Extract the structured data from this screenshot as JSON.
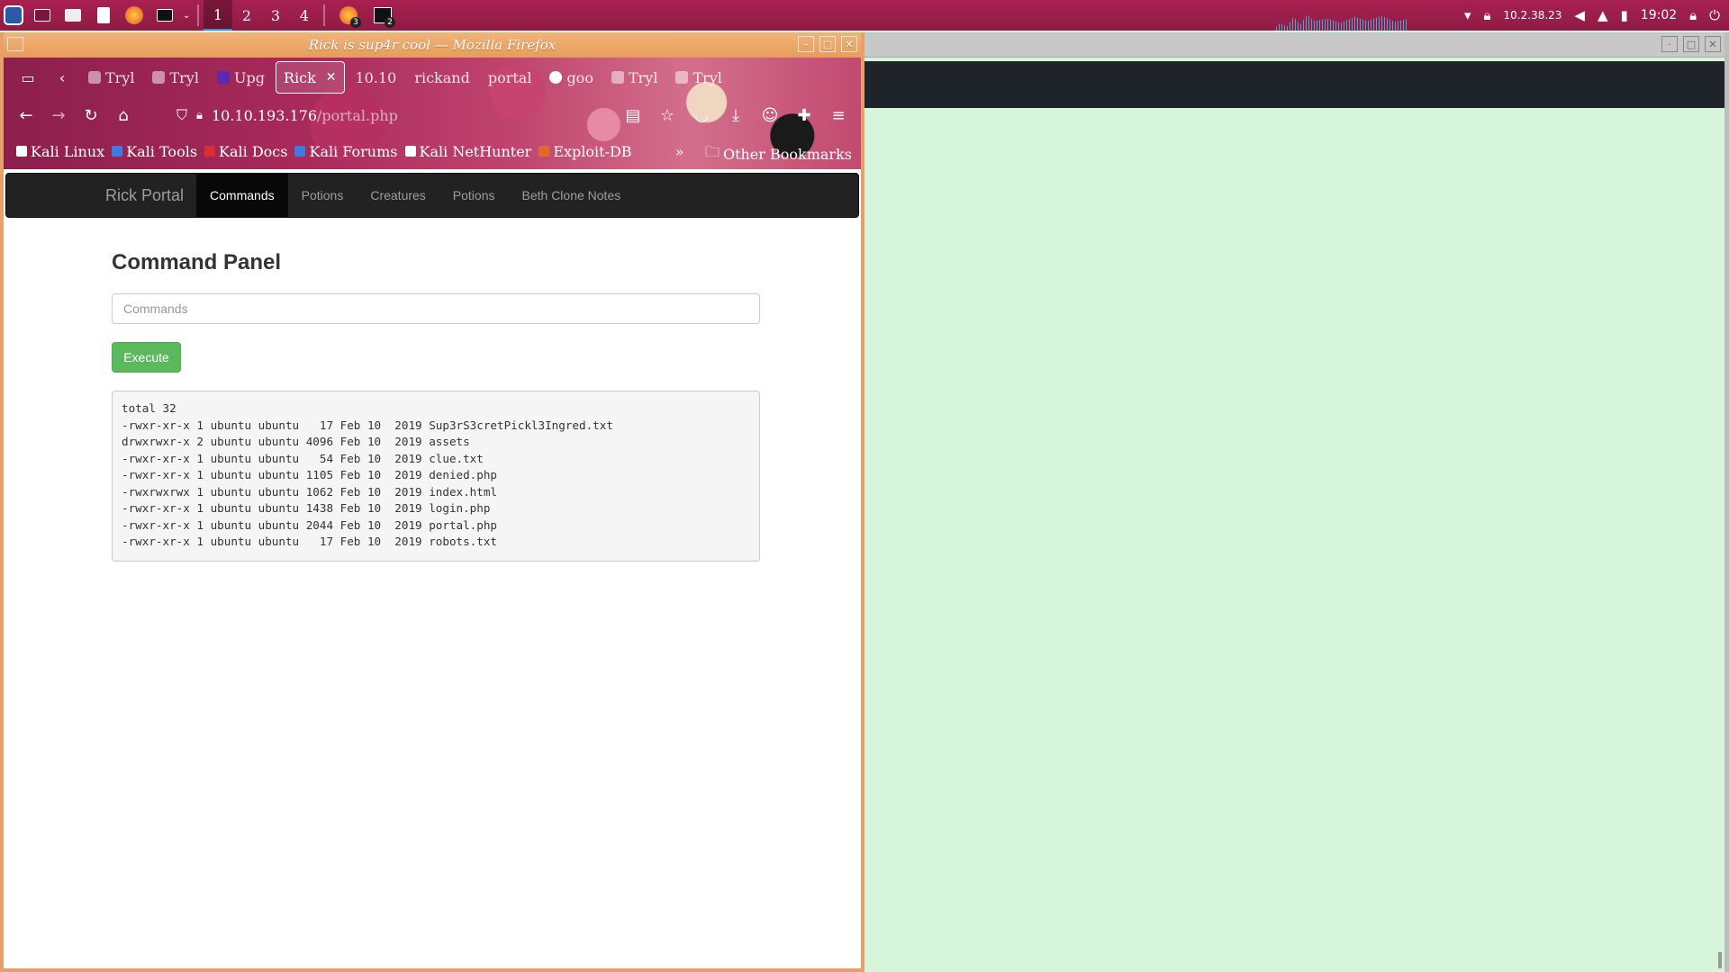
{
  "panel": {
    "workspaces": [
      "1",
      "2",
      "3",
      "4"
    ],
    "active_workspace": "1",
    "firefox_badge": "3",
    "terminal_badge": "2",
    "ip": "10.2.38.23",
    "time": "19:02"
  },
  "firefox": {
    "window_title": "Rick is sup4r cool — Mozilla Firefox",
    "tabs": [
      {
        "label": "Tryl"
      },
      {
        "label": "Tryl"
      },
      {
        "label": "Upg"
      },
      {
        "label": "Rick",
        "active": true
      },
      {
        "label": "10.10"
      },
      {
        "label": "rickand"
      },
      {
        "label": "portal"
      },
      {
        "label": "goo"
      },
      {
        "label": "Tryl"
      },
      {
        "label": "Tryl"
      }
    ],
    "url_host": "10.10.193.176",
    "url_path": "/portal.php",
    "bookmarks": [
      {
        "label": "Kali Linux",
        "color": "#ffffff"
      },
      {
        "label": "Kali Tools",
        "color": "#3d7be0"
      },
      {
        "label": "Kali Docs",
        "color": "#d83030"
      },
      {
        "label": "Kali Forums",
        "color": "#3d7be0"
      },
      {
        "label": "Kali NetHunter",
        "color": "#ffffff"
      },
      {
        "label": "Exploit-DB",
        "color": "#e06a2a"
      }
    ],
    "other_bookmarks": "Other Bookmarks"
  },
  "page": {
    "brand": "Rick Portal",
    "nav": [
      "Commands",
      "Potions",
      "Creatures",
      "Potions",
      "Beth Clone Notes"
    ],
    "active_nav": "Commands",
    "title": "Command Panel",
    "input_placeholder": "Commands",
    "execute_label": "Execute",
    "output_lines": [
      "total 32",
      "-rwxr-xr-x 1 ubuntu ubuntu   17 Feb 10  2019 Sup3rS3cretPickl3Ingred.txt",
      "drwxrwxr-x 2 ubuntu ubuntu 4096 Feb 10  2019 assets",
      "-rwxr-xr-x 1 ubuntu ubuntu   54 Feb 10  2019 clue.txt",
      "-rwxr-xr-x 1 ubuntu ubuntu 1105 Feb 10  2019 denied.php",
      "-rwxrwxrwx 1 ubuntu ubuntu 1062 Feb 10  2019 index.html",
      "-rwxr-xr-x 1 ubuntu ubuntu 1438 Feb 10  2019 login.php",
      "-rwxr-xr-x 1 ubuntu ubuntu 2044 Feb 10  2019 portal.php",
      "-rwxr-xr-x 1 ubuntu ubuntu   17 Feb 10  2019 robots.txt"
    ],
    "execute_color": "#5cb85c"
  }
}
